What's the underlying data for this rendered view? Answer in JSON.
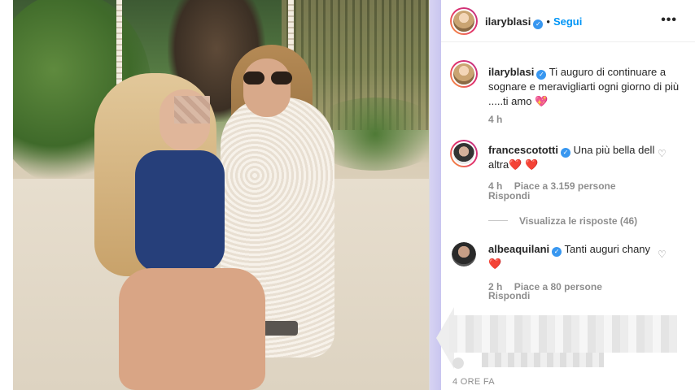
{
  "post": {
    "author": "ilaryblasi",
    "follow_label": "Segui",
    "more_label": "•••",
    "caption_user": "ilaryblasi",
    "caption_text": "Ti auguro di continuare a sognare e meravigliarti ogni giorno di più .....ti amo 💖",
    "caption_time": "4 h"
  },
  "comments": [
    {
      "user": "francescototti",
      "text": "Una più bella dell altra❤️ ❤️",
      "time": "4 h",
      "likes": "Piace a 3.159 persone",
      "reply": "Rispondi",
      "view_replies": "Visualizza le risposte (46)"
    },
    {
      "user": "albeaquilani",
      "text": "Tanti auguri chany❤️",
      "time": "2 h",
      "likes": "Piace a 80 persone",
      "reply": "Rispondi"
    }
  ],
  "footer": {
    "time_ago": "4 ORE FA"
  },
  "icons": {
    "verified": "verified-badge-icon",
    "heart": "heart-outline-icon",
    "more": "more-options-icon"
  },
  "colors": {
    "link_blue": "#0095f6",
    "verified_blue": "#3897f0",
    "muted": "#8e8e8e",
    "text": "#262626"
  }
}
